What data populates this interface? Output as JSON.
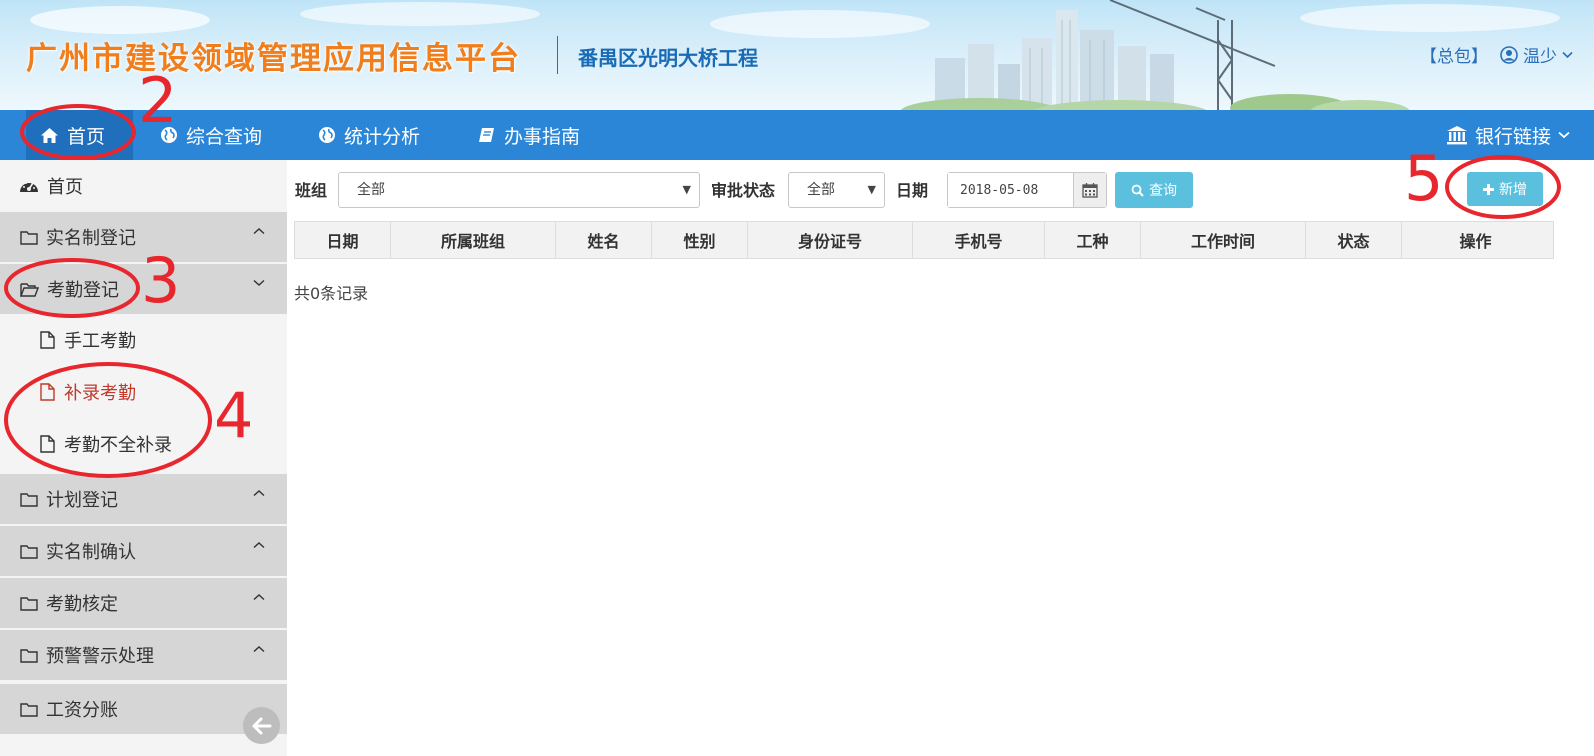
{
  "header": {
    "app_title": "广州市建设领域管理应用信息平台",
    "project_name": "番禺区光明大桥工程",
    "role_label": "【总包】",
    "user_name": "温少"
  },
  "topnav": {
    "items": [
      {
        "label": "首页",
        "icon": "home-icon",
        "active": true
      },
      {
        "label": "综合查询",
        "icon": "globe-icon"
      },
      {
        "label": "统计分析",
        "icon": "globe-icon"
      },
      {
        "label": "办事指南",
        "icon": "book-icon"
      }
    ],
    "bank_link": "银行链接"
  },
  "sidebar": {
    "home": "首页",
    "groups": [
      {
        "label": "实名制登记",
        "expanded": false
      },
      {
        "label": "考勤登记",
        "expanded": true,
        "items": [
          {
            "label": "手工考勤"
          },
          {
            "label": "补录考勤",
            "active": true
          },
          {
            "label": "考勤不全补录"
          }
        ]
      },
      {
        "label": "计划登记",
        "expanded": false
      },
      {
        "label": "实名制确认",
        "expanded": false
      },
      {
        "label": "考勤核定",
        "expanded": false
      },
      {
        "label": "预警警示处理",
        "expanded": false
      },
      {
        "label": "工资分账",
        "expanded": false
      }
    ]
  },
  "filters": {
    "team_label": "班组",
    "team_value": "全部",
    "status_label": "审批状态",
    "status_value": "全部",
    "date_label": "日期",
    "date_value": "2018-05-08",
    "query_button": "查询",
    "add_button": "新增"
  },
  "table": {
    "columns": [
      "日期",
      "所属班组",
      "姓名",
      "性别",
      "身份证号",
      "手机号",
      "工种",
      "工作时间",
      "状态",
      "操作"
    ],
    "rows": [],
    "record_count": "共0条记录"
  },
  "annotations": {
    "step_2": "2",
    "step_3": "3",
    "step_4": "4",
    "step_5": "5"
  },
  "colors": {
    "nav_blue": "#2b86d8",
    "nav_active": "#1f6fbd",
    "title_orange": "#f07e1c",
    "button_info": "#5bc0de",
    "annotation_red": "#e8262d",
    "active_sub_item": "#c0392b"
  }
}
